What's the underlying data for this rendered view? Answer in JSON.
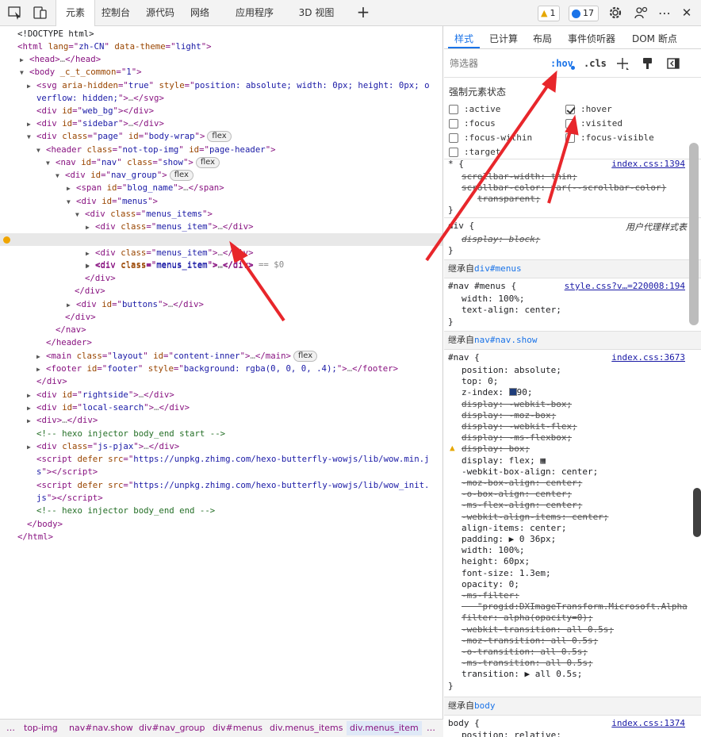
{
  "toolbar": {
    "tabs": [
      {
        "label": "元素"
      },
      {
        "label": "控制台"
      },
      {
        "label": "源代码"
      },
      {
        "label": "网络"
      },
      {
        "label": "应用程序"
      },
      {
        "label": "3D 视图"
      }
    ],
    "add_tab": "+",
    "warnings": "1",
    "messages": "17",
    "more": "⋯",
    "close": "✕"
  },
  "dom": {
    "lines": [
      {
        "html": "<span class=\"tx\">&lt;!DOCTYPE html&gt;</span>"
      },
      {
        "html": "&lt;<span class=\"tn\">html</span> <span class=\"an\">lang</span>=\"<span class=\"av\">zh-CN</span>\" <span class=\"an\">data-theme</span>=\"<span class=\"av\">light</span>\"&gt;"
      },
      {
        "html": "<span class=\"tri\">▶</span>&lt;<span class=\"tn\">head</span>&gt;<span class=\"dim\">…</span>&lt;/<span class=\"tn\">head</span>&gt;"
      },
      {
        "html": "<span class=\"tri\">▼</span>&lt;<span class=\"tn\">body</span> <span class=\"an\">_c_t_common</span>=\"<span class=\"av\">1</span>\"&gt;"
      },
      {
        "html": "<span class=\"tri\">▶</span>&lt;<span class=\"tn\">svg</span> <span class=\"an\">aria-hidden</span>=\"<span class=\"av\">true</span>\" <span class=\"an\">style</span>=\"<span class=\"av\">position: absolute; width: 0px; height: 0px; o</span>"
      },
      {
        "html": "<span class=\"av\">verflow: hidden;</span>\"&gt;<span class=\"dim\">…</span>&lt;/<span class=\"tn\">svg</span>&gt;"
      },
      {
        "html": "&lt;<span class=\"tn\">div</span> <span class=\"an\">id</span>=\"<span class=\"av\">web_bg</span>\"&gt;&lt;/<span class=\"tn\">div</span>&gt;"
      },
      {
        "html": "<span class=\"tri\">▶</span>&lt;<span class=\"tn\">div</span> <span class=\"an\">id</span>=\"<span class=\"av\">sidebar</span>\"&gt;<span class=\"dim\">…</span>&lt;/<span class=\"tn\">div</span>&gt;"
      },
      {
        "html": "<span class=\"tri\">▼</span>&lt;<span class=\"tn\">div</span> <span class=\"an\">class</span>=\"<span class=\"av\">page</span>\" <span class=\"an\">id</span>=\"<span class=\"av\">body-wrap</span>\"&gt;<span class=\"chip\">flex</span>"
      },
      {
        "html": "<span class=\"tri\">▼</span>&lt;<span class=\"tn\">header</span> <span class=\"an\">class</span>=\"<span class=\"av\">not-top-img</span>\" <span class=\"an\">id</span>=\"<span class=\"av\">page-header</span>\"&gt;"
      },
      {
        "html": "<span class=\"tri\">▼</span>&lt;<span class=\"tn\">nav</span> <span class=\"an\">id</span>=\"<span class=\"av\">nav</span>\" <span class=\"an\">class</span>=\"<span class=\"av\">show</span>\"&gt;<span class=\"chip\">flex</span>"
      },
      {
        "html": "<span class=\"tri\">▼</span>&lt;<span class=\"tn\">div</span> <span class=\"an\">id</span>=\"<span class=\"av\">nav_group</span>\"&gt;<span class=\"chip\">flex</span>"
      },
      {
        "html": "<span class=\"tri\">▶</span>&lt;<span class=\"tn\">span</span> <span class=\"an\">id</span>=\"<span class=\"av\">blog_name</span>\"&gt;<span class=\"dim\">…</span>&lt;/<span class=\"tn\">span</span>&gt;"
      },
      {
        "html": "<span class=\"tri\">▼</span>&lt;<span class=\"tn\">div</span> <span class=\"an\">id</span>=\"<span class=\"av\">menus</span>\"&gt;"
      },
      {
        "html": "<span class=\"tri\">▼</span>&lt;<span class=\"tn\">div</span> <span class=\"an\">class</span>=\"<span class=\"av\">menus_items</span>\"&gt;"
      },
      {
        "html": "<span class=\"tri\">▶</span>&lt;<span class=\"tn\">div</span> <span class=\"an\">class</span>=\"<span class=\"av\">menus_item</span>\"&gt;<span class=\"dim\">…</span>&lt;/<span class=\"tn\">div</span>&gt;"
      },
      {
        "html": "<span class=\"tri\">▶</span>&lt;<span class=\"tn\">div</span> <span class=\"an\">class</span>=\"<span class=\"av\">menus_item</span>\"&gt;<span class=\"dim\">…</span>&lt;/<span class=\"tn\">div</span>&gt; <span class=\"dim\">== $0</span>"
      },
      {
        "html": "<span class=\"tri\">▶</span>&lt;<span class=\"tn\">div</span> <span class=\"an\">class</span>=\"<span class=\"av\">menus_item</span>\"&gt;<span class=\"dim\">…</span>&lt;/<span class=\"tn\">div</span>&gt;"
      },
      {
        "html": "<span class=\"tri\">▶</span>&lt;<span class=\"tn\">div</span> <span class=\"an\">class</span>=\"<span class=\"av\">menus_item</span>\"&gt;<span class=\"dim\">…</span>&lt;/<span class=\"tn\">div</span>&gt;"
      },
      {
        "html": "&lt;/<span class=\"tn\">div</span>&gt;"
      },
      {
        "html": "&lt;/<span class=\"tn\">div</span>&gt;"
      },
      {
        "html": "<span class=\"tri\">▶</span>&lt;<span class=\"tn\">div</span> <span class=\"an\">id</span>=\"<span class=\"av\">buttons</span>\"&gt;<span class=\"dim\">…</span>&lt;/<span class=\"tn\">div</span>&gt;"
      },
      {
        "html": "&lt;/<span class=\"tn\">div</span>&gt;"
      },
      {
        "html": "&lt;/<span class=\"tn\">nav</span>&gt;"
      },
      {
        "html": "&lt;/<span class=\"tn\">header</span>&gt;"
      },
      {
        "html": "<span class=\"tri\">▶</span>&lt;<span class=\"tn\">main</span> <span class=\"an\">class</span>=\"<span class=\"av\">layout</span>\" <span class=\"an\">id</span>=\"<span class=\"av\">content-inner</span>\"&gt;<span class=\"dim\">…</span>&lt;/<span class=\"tn\">main</span>&gt;<span class=\"chip\">flex</span>"
      },
      {
        "html": "<span class=\"tri\">▶</span>&lt;<span class=\"tn\">footer</span> <span class=\"an\">id</span>=\"<span class=\"av\">footer</span>\" <span class=\"an\">style</span>=\"<span class=\"av\">background: rgba(0, 0, 0, .4);</span>\"&gt;<span class=\"dim\">…</span>&lt;/<span class=\"tn\">footer</span>&gt;"
      },
      {
        "html": "&lt;/<span class=\"tn\">div</span>&gt;"
      },
      {
        "html": "<span class=\"tri\">▶</span>&lt;<span class=\"tn\">div</span> <span class=\"an\">id</span>=\"<span class=\"av\">rightside</span>\"&gt;<span class=\"dim\">…</span>&lt;/<span class=\"tn\">div</span>&gt;"
      },
      {
        "html": "<span class=\"tri\">▶</span>&lt;<span class=\"tn\">div</span> <span class=\"an\">id</span>=\"<span class=\"av\">local-search</span>\"&gt;<span class=\"dim\">…</span>&lt;/<span class=\"tn\">div</span>&gt;"
      },
      {
        "html": "<span class=\"tri\">▶</span>&lt;<span class=\"tn\">div</span>&gt;<span class=\"dim\">…</span>&lt;/<span class=\"tn\">div</span>&gt;"
      },
      {
        "html": "<span class=\"cm\">&lt;!-- hexo injector body_end start --&gt;</span>"
      },
      {
        "html": "<span class=\"tri\">▶</span>&lt;<span class=\"tn\">div</span> <span class=\"an\">class</span>=\"<span class=\"av\">js-pjax</span>\"&gt;<span class=\"dim\">…</span>&lt;/<span class=\"tn\">div</span>&gt;"
      },
      {
        "html": "&lt;<span class=\"tn\">script</span> <span class=\"an\">defer</span> <span class=\"an\">src</span>=\"<span class=\"av\">https://unpkg.zhimg.com/hexo-butterfly-wowjs/lib/wow.min.j</span>"
      },
      {
        "html": "<span class=\"av\">s</span>\"&gt;&lt;/<span class=\"tn\">script</span>&gt;"
      },
      {
        "html": "&lt;<span class=\"tn\">script</span> <span class=\"an\">defer</span> <span class=\"an\">src</span>=\"<span class=\"av\">https://unpkg.zhimg.com/hexo-butterfly-wowjs/lib/wow_init.</span>"
      },
      {
        "html": "<span class=\"av\">js</span>\"&gt;&lt;/<span class=\"tn\">script</span>&gt;"
      },
      {
        "html": "<span class=\"cm\">&lt;!-- hexo injector body_end end --&gt;</span>"
      },
      {
        "html": "&lt;/<span class=\"tn\">body</span>&gt;"
      },
      {
        "html": "&lt;/<span class=\"tn\">html</span>&gt;"
      }
    ]
  },
  "breadcrumbs": {
    "more": "…",
    "items": [
      "top-img",
      "nav#nav.show",
      "div#nav_group",
      "div#menus",
      "div.menus_items",
      "div.menus_item"
    ],
    "more_right": "…"
  },
  "styles": {
    "tabs": [
      "样式",
      "已计算",
      "布局",
      "事件侦听器",
      "DOM 断点"
    ],
    "filter_placeholder": "筛选器",
    "hov": ":hov",
    "cls": ".cls",
    "force_title": "强制元素状态",
    "pseudos": [
      {
        "label": ":active",
        "checked": false
      },
      {
        "label": ":hover",
        "checked": true
      },
      {
        "label": ":focus",
        "checked": false
      },
      {
        "label": ":visited",
        "checked": false
      },
      {
        "label": ":focus-within",
        "checked": false
      },
      {
        "label": ":focus-visible",
        "checked": false
      },
      {
        "label": ":target",
        "checked": false
      }
    ],
    "rule1": {
      "selector": "* {",
      "source": "index.css:1394",
      "l1": "scrollbar-width: thin;",
      "l2": "scrollbar-color: var(--scrollbar-color)",
      "l3": "transparent;",
      "close": "}"
    },
    "rule2": {
      "selector": "div {",
      "source": "用户代理样式表",
      "l1": "display: block;",
      "close": "}"
    },
    "inherit1": {
      "prefix": "继承自",
      "target": "div#menus"
    },
    "rule3": {
      "selector": "#nav #menus {",
      "source": "style.css?v…=220008:194",
      "l1": "width: 100%;",
      "l2": "text-align: center;",
      "close": "}"
    },
    "inherit2": {
      "prefix": "继承自",
      "target": "nav#nav.show"
    },
    "rule4": {
      "selector": "#nav {",
      "source": "index.css:3673",
      "lines": [
        {
          "t": "position: absolute;",
          "s": false
        },
        {
          "t": "top: 0;",
          "s": false
        },
        {
          "t": "z-index: ",
          "s": false,
          "swatch": true,
          "after": "90;"
        },
        {
          "t": "display: -webkit-box;",
          "s": true
        },
        {
          "t": "display: -moz-box;",
          "s": true
        },
        {
          "t": "display: -webkit-flex;",
          "s": true
        },
        {
          "t": "display: -ms-flexbox;",
          "s": true
        },
        {
          "t": "display: box;",
          "s": true,
          "warn": true
        },
        {
          "t": "display: flex; ▦",
          "s": false
        },
        {
          "t": "-webkit-box-align: center;",
          "s": false
        },
        {
          "t": "-moz-box-align: center;",
          "s": true
        },
        {
          "t": "-o-box-align: center;",
          "s": true
        },
        {
          "t": "-ms-flex-align: center;",
          "s": true
        },
        {
          "t": "-webkit-align-items: center;",
          "s": true
        },
        {
          "t": "align-items: center;",
          "s": false
        },
        {
          "t": "padding: ▶ 0 36px;",
          "s": false
        },
        {
          "t": "width: 100%;",
          "s": false
        },
        {
          "t": "height: 60px;",
          "s": false
        },
        {
          "t": "font-size: 1.3em;",
          "s": false
        },
        {
          "t": "opacity: 0;",
          "s": false
        },
        {
          "t": "-ms-filter:",
          "s": true
        },
        {
          "t": "   \"progid:DXImageTransform.Microsoft.Alpha",
          "s": true
        },
        {
          "t": "filter: alpha(opacity=0);",
          "s": true
        },
        {
          "t": "-webkit-transition: all 0.5s;",
          "s": true
        },
        {
          "t": "-moz-transition: all 0.5s;",
          "s": true
        },
        {
          "t": "-o-transition: all 0.5s;",
          "s": true
        },
        {
          "t": "-ms-transition: all 0.5s;",
          "s": true
        },
        {
          "t": "transition: ▶ all 0.5s;",
          "s": false
        }
      ],
      "close": "}"
    },
    "inherit3": {
      "prefix": "继承自",
      "target": "body"
    },
    "rule5": {
      "selector": "body {",
      "source": "index.css:1374",
      "l1": "position: relative;"
    }
  },
  "colors": {
    "accent": "#1a73e8",
    "arrow": "#e8262b",
    "selected_row": "#e8e8e8"
  }
}
